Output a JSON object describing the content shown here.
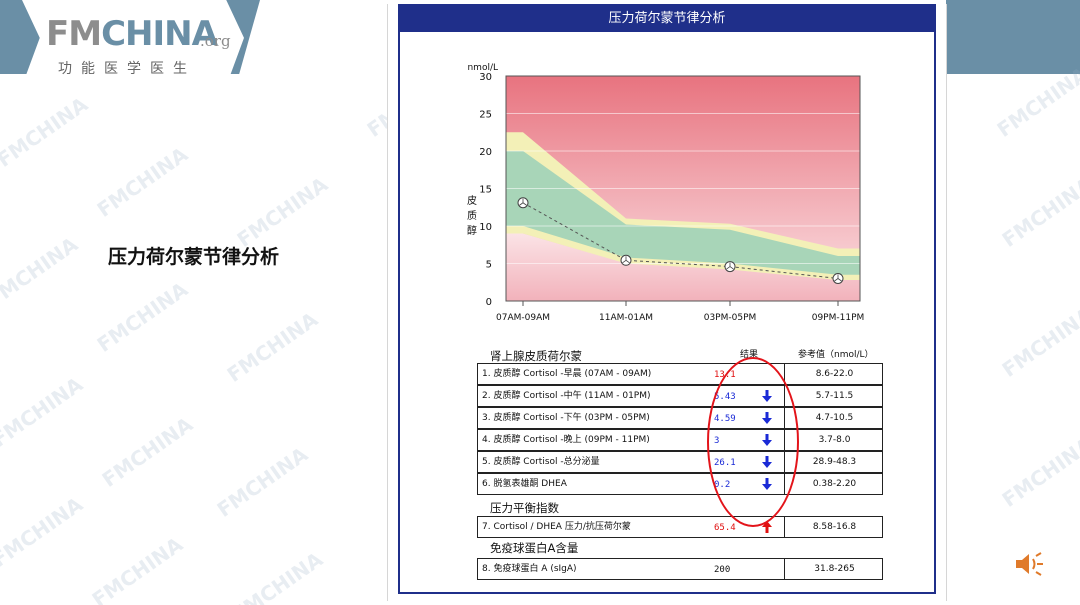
{
  "logo": {
    "brand_a": "FM",
    "brand_b": "CHINA",
    "suffix": ".org",
    "subtitle": "功能医学医生"
  },
  "watermark": "FMCHINA",
  "slide_title": "压力荷尔蒙节律分析",
  "report_title": "压力荷尔蒙节律分析",
  "chart_data": {
    "type": "line",
    "title": "",
    "unit_label": "nmol/L",
    "ylabel": "皮质醇",
    "ylim": [
      0,
      30
    ],
    "y_ticks": [
      0,
      5,
      10,
      15,
      20,
      25,
      30
    ],
    "categories": [
      "07AM-09AM",
      "11AM-01AM",
      "03PM-05PM",
      "09PM-11PM"
    ],
    "series": [
      {
        "values": [
          13.1,
          5.43,
          4.59,
          3.0
        ]
      }
    ],
    "bands": {
      "outer_upper": [
        22.5,
        11.0,
        10.3,
        7.0
      ],
      "inner_upper": [
        20.0,
        10.2,
        9.5,
        6.0
      ],
      "inner_lower": [
        10.0,
        5.8,
        5.0,
        3.5
      ],
      "outer_lower": [
        9.0,
        5.0,
        4.2,
        2.8
      ]
    },
    "colors": {
      "high_zone": "#e8737f",
      "low_zone": "#f2b2bb",
      "outer_band": "#f3f0b7",
      "inner_band": "#a8d5b8",
      "line": "#555555"
    },
    "grid": true
  },
  "table": {
    "section1": "肾上腺皮质荷尔蒙",
    "col_result": "结果",
    "col_ref": "参考值（nmol/L）",
    "rows": [
      {
        "name": "1. 皮质醇 Cortisol -早晨 (07AM - 09AM)",
        "value": "13.1",
        "ref": "8.6-22.0",
        "flag": "",
        "color": "#e01010"
      },
      {
        "name": "2. 皮质醇 Cortisol -中午 (11AM - 01PM)",
        "value": "5.43",
        "ref": "5.7-11.5",
        "flag": "down",
        "color": "#1a2ad6"
      },
      {
        "name": "3. 皮质醇 Cortisol -下午 (03PM - 05PM)",
        "value": "4.59",
        "ref": "4.7-10.5",
        "flag": "down",
        "color": "#1a2ad6"
      },
      {
        "name": "4. 皮质醇 Cortisol -晚上 (09PM - 11PM)",
        "value": "3",
        "ref": "3.7-8.0",
        "flag": "down",
        "color": "#1a2ad6"
      },
      {
        "name": "5. 皮质醇 Cortisol -总分泌量",
        "value": "26.1",
        "ref": "28.9-48.3",
        "flag": "down",
        "color": "#1a2ad6"
      },
      {
        "name": "6. 脱氢表雄酮 DHEA",
        "value": "0.2",
        "ref": "0.38-2.20",
        "flag": "down",
        "color": "#1a2ad6"
      }
    ],
    "section2": "压力平衡指数",
    "row7": {
      "name": "7. Cortisol / DHEA 压力/抗压荷尔蒙",
      "value": "65.4",
      "ref": "8.58-16.8",
      "flag": "up",
      "color": "#e01010"
    },
    "section3": "免疫球蛋白A含量",
    "row8": {
      "name": "8. 免疫球蛋白 A (sIgA)",
      "value": "200",
      "ref": "31.8-265",
      "flag": "",
      "color": "#111111"
    }
  }
}
